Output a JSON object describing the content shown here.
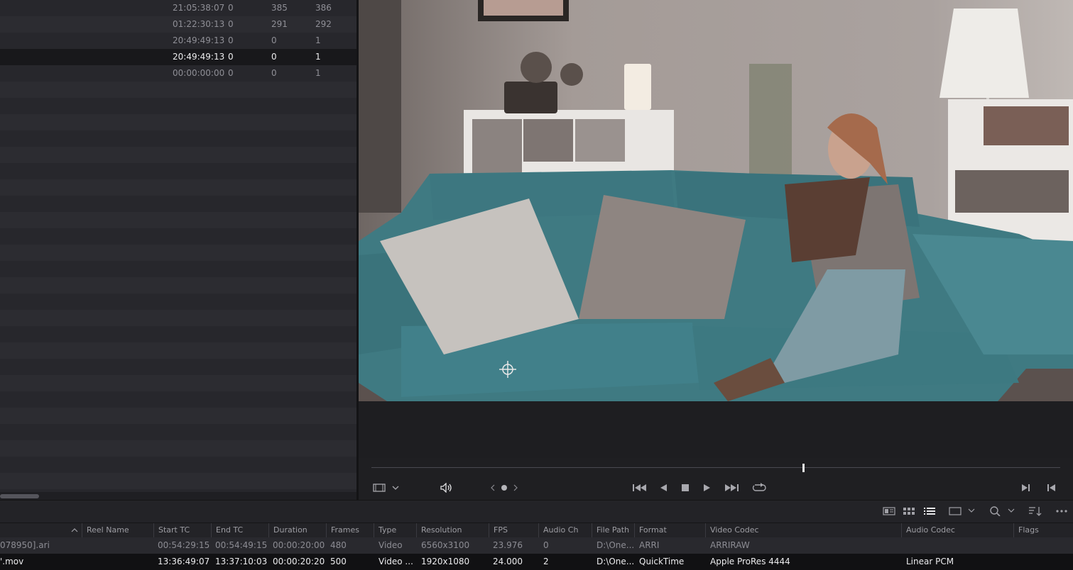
{
  "left_list": {
    "rows": [
      {
        "tc": "21:05:38:07",
        "a": "0",
        "b": "385",
        "c": "386",
        "selected": false
      },
      {
        "tc": "01:22:30:13",
        "a": "0",
        "b": "291",
        "c": "292",
        "selected": false
      },
      {
        "tc": "20:49:49:13",
        "a": "0",
        "b": "0",
        "c": "1",
        "selected": false
      },
      {
        "tc": "20:49:49:13",
        "a": "0",
        "b": "0",
        "c": "1",
        "selected": true
      },
      {
        "tc": "00:00:00:00",
        "a": "0",
        "b": "0",
        "c": "1",
        "selected": false
      }
    ]
  },
  "viewer": {
    "scrub_position": 0.627
  },
  "transport": {
    "view_options_icon": "filmstrip-icon",
    "audio_icon": "speaker-icon",
    "jog_icon": "jog-wheel-icon",
    "controls": [
      "skip-to-start-icon",
      "play-reverse-icon",
      "stop-icon",
      "play-icon",
      "skip-to-end-icon",
      "loop-icon"
    ],
    "right_controls": [
      "next-clip-icon",
      "previous-clip-icon"
    ]
  },
  "pool_toolbar": {
    "icons": [
      "metadata-view-icon",
      "thumbnail-view-icon",
      "list-view-icon",
      "clip-size-icon",
      "search-icon",
      "sort-icon",
      "more-options-icon"
    ]
  },
  "media_pool": {
    "columns": [
      "Reel Name",
      "Start TC",
      "End TC",
      "Duration",
      "Frames",
      "Type",
      "Resolution",
      "FPS",
      "Audio Ch",
      "File Path",
      "Format",
      "Video Codec",
      "Audio Codec",
      "Flags"
    ],
    "rows": [
      {
        "clip_name": "078950].ari",
        "reel_name": "",
        "start_tc": "00:54:29:15",
        "end_tc": "00:54:49:15",
        "duration": "00:00:20:00",
        "frames": "480",
        "type": "Video",
        "resolution": "6560x3100",
        "fps": "23.976",
        "audio_ch": "0",
        "file_path": "D:\\One...",
        "format": "ARRI",
        "video_codec": "ARRIRAW",
        "audio_codec": "",
        "flags": ""
      },
      {
        "clip_name": "'.mov",
        "reel_name": "",
        "start_tc": "13:36:49:07",
        "end_tc": "13:37:10:03",
        "duration": "00:00:20:20",
        "frames": "500",
        "type": "Video ...",
        "resolution": "1920x1080",
        "fps": "24.000",
        "audio_ch": "2",
        "file_path": "D:\\One...",
        "format": "QuickTime",
        "video_codec": "Apple ProRes 4444",
        "audio_codec": "Linear PCM",
        "flags": ""
      }
    ]
  }
}
